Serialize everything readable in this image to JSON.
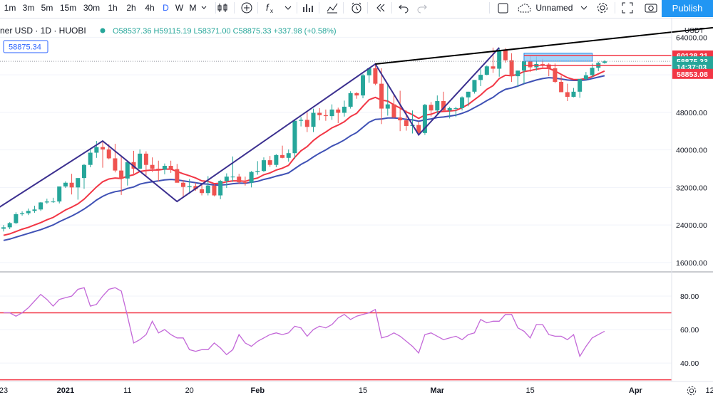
{
  "toolbar": {
    "intervals": [
      "1m",
      "3m",
      "5m",
      "15m",
      "30m",
      "1h",
      "2h",
      "4h",
      "D",
      "W",
      "M"
    ],
    "active_interval": "D",
    "layout_name": "Unnamed",
    "publish_label": "Publish",
    "icons": [
      "candles-icon",
      "plus-circle-icon",
      "fx-icon",
      "bars-indicator-icon",
      "templates-icon",
      "alert-clock-icon",
      "replay-icon",
      "undo-icon",
      "redo-icon",
      "fullscreen-icon",
      "settings-icon",
      "camera-icon"
    ]
  },
  "legend": {
    "symbol": "ner USD · 1D · HUOBI",
    "ohlc": "O58537.36 H59115.19 L58371.00 C58875.33 +337.98 (+0.58%)",
    "price_tag": "58875.34"
  },
  "price_axis": {
    "currency": "USDT",
    "ticks": [
      "64000.00",
      "56000.00",
      "48000.00",
      "40000.00",
      "32000.00",
      "24000.00",
      "16000.00"
    ],
    "tick_values": [
      64000,
      56000,
      48000,
      40000,
      32000,
      24000,
      16000
    ],
    "labels": [
      {
        "text": "60128.21",
        "value": 60128.21,
        "color": "#f23645"
      },
      {
        "text": "58875.33",
        "value": 58875.33,
        "color": "#26a69a"
      },
      {
        "text": "14:37:03",
        "value": 57700,
        "color": "#26a69a"
      },
      {
        "text": "58853.08",
        "value": 56200,
        "color": "#f23645"
      }
    ]
  },
  "rsi_axis": {
    "ticks": [
      "80.00",
      "60.00",
      "40.00"
    ],
    "tick_values": [
      80,
      60,
      40
    ]
  },
  "time_axis": {
    "labels": [
      "23",
      "2021",
      "11",
      "20",
      "Feb",
      "15",
      "Mar",
      "15",
      "Apr",
      "12"
    ],
    "bar_index": [
      0,
      10,
      20,
      30,
      41,
      58,
      70,
      85,
      102,
      114
    ]
  },
  "colors": {
    "up": "#26a69a",
    "down": "#ef5350",
    "ema_fast": "#f23645",
    "ema_slow": "#3f51b5",
    "pattern": "#3b2f8f",
    "trend": "#000000",
    "rsi": "#c368d8",
    "rsi_band": "#f23645",
    "zone": "#90caf9"
  },
  "chart_data": {
    "type": "candlestick",
    "x": [
      "2020-12-23",
      "2020-12-24",
      "2020-12-25",
      "2020-12-26",
      "2020-12-27",
      "2020-12-28",
      "2020-12-29",
      "2020-12-30",
      "2020-12-31",
      "2021-01-01",
      "2021-01-02",
      "2021-01-03",
      "2021-01-04",
      "2021-01-05",
      "2021-01-06",
      "2021-01-07",
      "2021-01-08",
      "2021-01-09",
      "2021-01-10",
      "2021-01-11",
      "2021-01-12",
      "2021-01-13",
      "2021-01-14",
      "2021-01-15",
      "2021-01-16",
      "2021-01-17",
      "2021-01-18",
      "2021-01-19",
      "2021-01-20",
      "2021-01-21",
      "2021-01-22",
      "2021-01-23",
      "2021-01-24",
      "2021-01-25",
      "2021-01-26",
      "2021-01-27",
      "2021-01-28",
      "2021-01-29",
      "2021-01-30",
      "2021-01-31",
      "2021-02-01",
      "2021-02-02",
      "2021-02-03",
      "2021-02-04",
      "2021-02-05",
      "2021-02-06",
      "2021-02-07",
      "2021-02-08",
      "2021-02-09",
      "2021-02-10",
      "2021-02-11",
      "2021-02-12",
      "2021-02-13",
      "2021-02-14",
      "2021-02-15",
      "2021-02-16",
      "2021-02-17",
      "2021-02-18",
      "2021-02-19",
      "2021-02-20",
      "2021-02-21",
      "2021-02-22",
      "2021-02-23",
      "2021-02-24",
      "2021-02-25",
      "2021-02-26",
      "2021-02-27",
      "2021-02-28",
      "2021-03-01",
      "2021-03-02",
      "2021-03-03",
      "2021-03-04",
      "2021-03-05",
      "2021-03-06",
      "2021-03-07",
      "2021-03-08",
      "2021-03-09",
      "2021-03-10",
      "2021-03-11",
      "2021-03-12",
      "2021-03-13",
      "2021-03-14",
      "2021-03-15",
      "2021-03-16",
      "2021-03-17",
      "2021-03-18",
      "2021-03-19",
      "2021-03-20",
      "2021-03-21",
      "2021-03-22",
      "2021-03-23",
      "2021-03-24",
      "2021-03-25",
      "2021-03-26",
      "2021-03-27",
      "2021-03-28",
      "2021-03-29",
      "2021-03-30"
    ],
    "open": [
      23200,
      23500,
      24400,
      26300,
      26500,
      27000,
      27300,
      28800,
      29000,
      29000,
      32200,
      33000,
      32000,
      34000,
      36800,
      39400,
      40600,
      40100,
      38200,
      35600,
      33900,
      37400,
      36000,
      39200,
      36800,
      36000,
      35800,
      36600,
      35900,
      33000,
      32100,
      32300,
      31600,
      30800,
      32400,
      30300,
      33400,
      34300,
      34300,
      33100,
      33000,
      35300,
      35500,
      37800,
      36800,
      38900,
      38300,
      39300,
      46200,
      46400,
      44900,
      47900,
      47400,
      47200,
      48600,
      47900,
      49200,
      52100,
      51600,
      55900,
      57400,
      54100,
      48800,
      49700,
      46900,
      46300,
      45100,
      45300,
      43600,
      49600,
      48400,
      50400,
      48400,
      48900,
      48900,
      51200,
      52400,
      54900,
      56000,
      57800,
      57300,
      61200,
      59100,
      55700,
      56900,
      58900,
      57600,
      58300,
      58200,
      57400,
      54500,
      52300,
      51300,
      52400,
      55100,
      55900,
      57500,
      58537.36
    ],
    "high": [
      24000,
      24600,
      26700,
      26900,
      27500,
      28100,
      28900,
      29600,
      29800,
      29600,
      33300,
      34900,
      33500,
      37000,
      40400,
      41900,
      41900,
      41200,
      41300,
      38500,
      37500,
      39800,
      40100,
      39700,
      38400,
      37700,
      37100,
      37700,
      37000,
      33600,
      33800,
      33000,
      32600,
      34400,
      32700,
      33600,
      35000,
      38600,
      34900,
      34300,
      35500,
      37600,
      38400,
      38700,
      39100,
      40900,
      40100,
      46600,
      47000,
      48000,
      48800,
      48900,
      48600,
      49700,
      49000,
      50500,
      52500,
      52300,
      56200,
      57500,
      58300,
      57400,
      54200,
      52000,
      52600,
      48400,
      48400,
      46000,
      49800,
      50200,
      51600,
      52400,
      49200,
      49200,
      51400,
      52400,
      54900,
      57200,
      58000,
      61800,
      61700,
      61700,
      60600,
      56900,
      58900,
      60000,
      59900,
      59400,
      58500,
      58400,
      55800,
      54100,
      53200,
      55100,
      56600,
      58400,
      58800,
      59115.19
    ],
    "low": [
      22600,
      23100,
      24200,
      26000,
      26100,
      26600,
      27000,
      28500,
      28700,
      28600,
      31900,
      30500,
      29400,
      31700,
      36300,
      38300,
      36200,
      38000,
      35200,
      30400,
      32400,
      34900,
      35900,
      34500,
      35300,
      33300,
      34800,
      35100,
      33500,
      30000,
      30600,
      31300,
      30300,
      30300,
      30100,
      29500,
      31900,
      33200,
      32700,
      32400,
      32000,
      34700,
      35300,
      36400,
      36300,
      38200,
      37500,
      38100,
      45000,
      43800,
      43800,
      46300,
      46200,
      46400,
      45700,
      47100,
      48800,
      50900,
      51000,
      54300,
      53800,
      45500,
      47300,
      46800,
      44000,
      44100,
      43500,
      43200,
      43200,
      47100,
      47400,
      48300,
      46700,
      47000,
      48400,
      49300,
      52000,
      53600,
      55900,
      56400,
      55600,
      58600,
      54500,
      53400,
      54100,
      56600,
      56900,
      57300,
      55700,
      54200,
      52300,
      50400,
      51200,
      51100,
      54800,
      55500,
      56800,
      58371
    ],
    "close": [
      23500,
      24400,
      26300,
      26500,
      27000,
      27300,
      28800,
      29000,
      29000,
      32200,
      33000,
      32000,
      34000,
      36800,
      39400,
      40600,
      40100,
      38200,
      35600,
      33900,
      37400,
      36000,
      39200,
      36800,
      36000,
      35800,
      36600,
      35900,
      33000,
      32100,
      32300,
      31600,
      30800,
      32400,
      30300,
      33400,
      34300,
      34300,
      33100,
      33000,
      35300,
      35500,
      37800,
      36800,
      38900,
      38300,
      39300,
      46200,
      46400,
      44900,
      47900,
      47400,
      47200,
      48600,
      47900,
      49200,
      52100,
      51600,
      55900,
      57400,
      54100,
      48800,
      49700,
      46900,
      46300,
      45100,
      45300,
      43600,
      49600,
      48400,
      50400,
      48400,
      48900,
      48900,
      51200,
      52400,
      54900,
      56000,
      57800,
      57300,
      61200,
      59100,
      55700,
      56900,
      58900,
      57600,
      58300,
      58200,
      57400,
      54500,
      52300,
      51300,
      52400,
      55100,
      55900,
      57500,
      58537.36,
      58875.33
    ],
    "ema_fast": [
      21800,
      22100,
      22600,
      23100,
      23500,
      24000,
      24500,
      25100,
      25600,
      26400,
      27200,
      27800,
      28500,
      29500,
      30800,
      32100,
      33200,
      33800,
      34000,
      33900,
      34400,
      34700,
      35400,
      35600,
      35700,
      35700,
      35900,
      35900,
      35400,
      34900,
      34500,
      34000,
      33400,
      33300,
      32800,
      32900,
      33200,
      33400,
      33400,
      33300,
      33700,
      34000,
      34700,
      35100,
      35700,
      36100,
      36700,
      38400,
      39800,
      40700,
      42000,
      43000,
      43800,
      44700,
      45300,
      46000,
      47100,
      47800,
      49300,
      50700,
      51200,
      50600,
      50400,
      49600,
      48900,
      48100,
      47500,
      46700,
      47400,
      47600,
      48100,
      48200,
      48300,
      48400,
      49000,
      49700,
      50700,
      51700,
      52900,
      53700,
      55200,
      55900,
      55800,
      56100,
      56700,
      56900,
      57200,
      57400,
      57400,
      56800,
      56100,
      55400,
      55000,
      55000,
      55200,
      55600,
      56200,
      56800
    ],
    "ema_slow": [
      20700,
      21000,
      21400,
      21800,
      22200,
      22600,
      23000,
      23500,
      24000,
      24700,
      25300,
      25900,
      26600,
      27400,
      28300,
      29300,
      30100,
      30700,
      31100,
      31300,
      31800,
      32100,
      32700,
      33000,
      33200,
      33400,
      33600,
      33700,
      33600,
      33400,
      33200,
      33000,
      32800,
      32700,
      32500,
      32500,
      32600,
      32800,
      32900,
      32900,
      33100,
      33300,
      33700,
      34000,
      34400,
      34700,
      35100,
      36000,
      36900,
      37600,
      38500,
      39300,
      40000,
      40800,
      41400,
      42100,
      43000,
      43700,
      44800,
      45900,
      46500,
      46600,
      46800,
      46800,
      46700,
      46500,
      46400,
      46100,
      46400,
      46600,
      46900,
      47000,
      47200,
      47400,
      47800,
      48300,
      49000,
      49700,
      50500,
      51200,
      52200,
      52900,
      53200,
      53600,
      54100,
      54500,
      54900,
      55200,
      55400,
      55300,
      55100,
      54900,
      54800,
      54800,
      54900,
      55200,
      55500,
      55800
    ],
    "rsi": [
      70,
      70,
      68,
      70,
      73,
      77,
      81,
      78,
      74,
      78,
      79,
      80,
      84,
      85,
      74,
      75,
      80,
      84,
      85,
      83,
      68,
      52,
      54,
      57,
      65,
      58,
      60,
      57,
      55,
      55,
      48,
      47,
      48,
      48,
      52,
      49,
      45,
      48,
      57,
      52,
      50,
      53,
      55,
      57,
      58,
      57,
      58,
      62,
      61,
      56,
      60,
      62,
      61,
      63,
      67,
      69,
      66,
      68,
      69,
      70,
      72,
      55,
      56,
      58,
      56,
      53,
      50,
      46,
      57,
      58,
      56,
      54,
      55,
      56,
      54,
      57,
      58,
      66,
      64,
      65,
      65,
      69,
      69,
      61,
      59,
      55,
      63,
      63,
      57,
      56,
      56,
      54,
      57,
      44,
      50,
      55,
      57,
      59
    ],
    "rsi_levels": [
      70,
      30
    ],
    "ylim": [
      14000,
      68000
    ],
    "rsi_ylim": [
      29,
      94
    ],
    "pattern_points": [
      {
        "x": "2020-12-22",
        "y": 27500
      },
      {
        "x": "2021-01-08",
        "y": 41900
      },
      {
        "x": "2021-01-20",
        "y": 29000
      },
      {
        "x": "2021-02-21",
        "y": 58300
      },
      {
        "x": "2021-02-28",
        "y": 43200
      },
      {
        "x": "2021-03-13",
        "y": 61800
      }
    ],
    "trendline": [
      {
        "x": "2021-02-21",
        "y": 58300
      },
      {
        "x": "2021-04-19",
        "y": 66400
      }
    ],
    "zone": {
      "x0": "2021-03-17",
      "x1": "2021-03-28",
      "y0": 58900,
      "y1": 60600
    },
    "hline": 58875.33
  }
}
